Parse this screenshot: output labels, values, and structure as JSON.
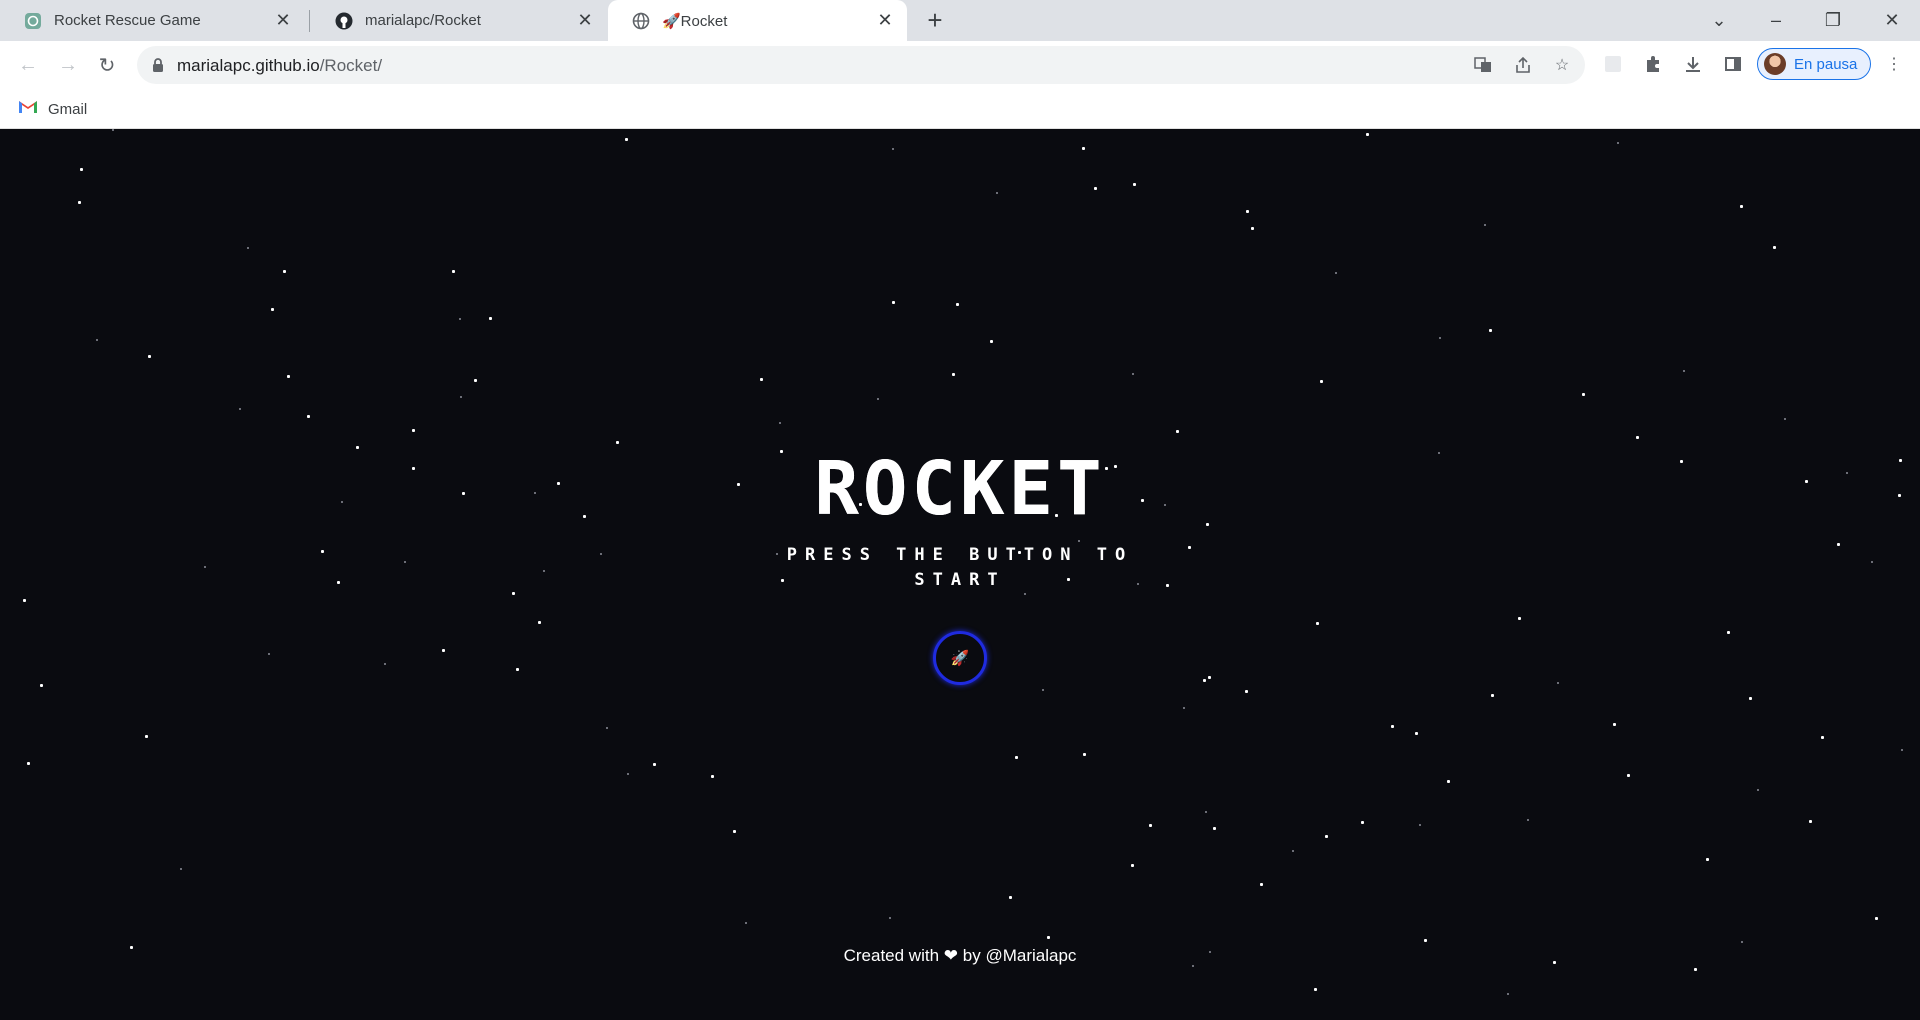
{
  "browser": {
    "tabs": [
      {
        "title": "Rocket Rescue Game",
        "favicon": "openai-icon",
        "active": false
      },
      {
        "title": "marialapc/Rocket",
        "favicon": "github-icon",
        "active": false
      },
      {
        "title": "🚀Rocket",
        "favicon": "globe-icon",
        "active": true
      }
    ],
    "url_host": "marialapc.github.io",
    "url_path": "/Rocket/",
    "profile_label": "En pausa",
    "bookmarks": [
      {
        "label": "Gmail",
        "icon": "gmail-icon"
      }
    ]
  },
  "game": {
    "title": "ROCKET",
    "subtitle": "PRESS THE BUTTON TO START",
    "start_button_glyph": "🚀",
    "footer_prefix": "Created with",
    "footer_heart": "❤",
    "footer_by": "by",
    "footer_author": "@Marialapc",
    "accent_color": "#1f2be0",
    "background_color": "#0a0b10"
  }
}
